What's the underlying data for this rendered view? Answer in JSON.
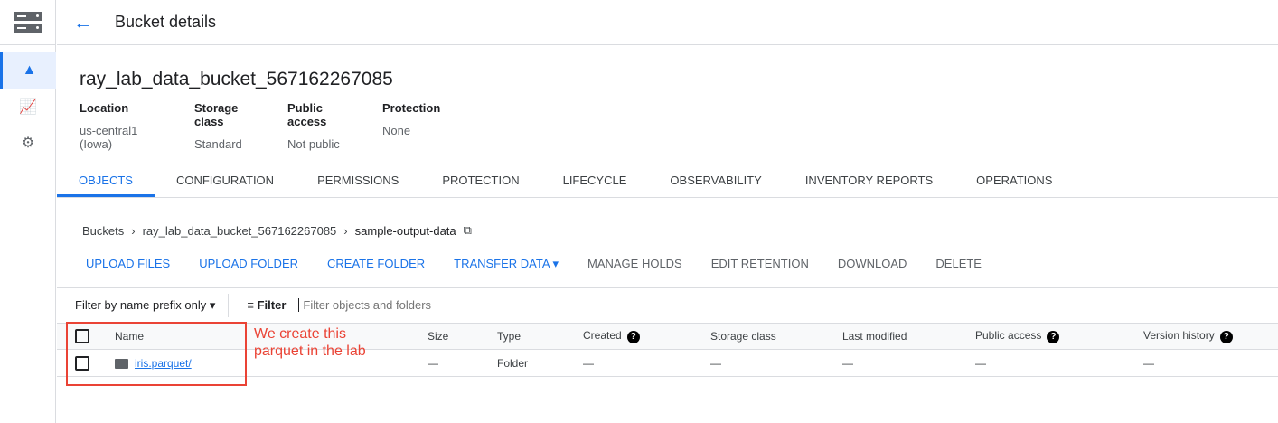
{
  "header": {
    "title": "Bucket details"
  },
  "bucket": {
    "name": "ray_lab_data_bucket_567162267085",
    "meta": [
      {
        "label": "Location",
        "value": "us-central1 (Iowa)"
      },
      {
        "label": "Storage class",
        "value": "Standard"
      },
      {
        "label": "Public access",
        "value": "Not public"
      },
      {
        "label": "Protection",
        "value": "None"
      }
    ]
  },
  "tabs": [
    "OBJECTS",
    "CONFIGURATION",
    "PERMISSIONS",
    "PROTECTION",
    "LIFECYCLE",
    "OBSERVABILITY",
    "INVENTORY REPORTS",
    "OPERATIONS"
  ],
  "breadcrumb": [
    "Buckets",
    "ray_lab_data_bucket_567162267085",
    "sample-output-data"
  ],
  "actions": {
    "upload_files": "UPLOAD FILES",
    "upload_folder": "UPLOAD FOLDER",
    "create_folder": "CREATE FOLDER",
    "transfer_data": "TRANSFER DATA",
    "manage_holds": "MANAGE HOLDS",
    "edit_retention": "EDIT RETENTION",
    "download": "DOWNLOAD",
    "delete": "DELETE"
  },
  "filter": {
    "prefix": "Filter by name prefix only",
    "label": "Filter",
    "placeholder": "Filter objects and folders"
  },
  "table": {
    "headers": [
      "Name",
      "Size",
      "Type",
      "Created",
      "Storage class",
      "Last modified",
      "Public access",
      "Version history"
    ],
    "rows": [
      {
        "name": "iris.parquet/",
        "size": "—",
        "type": "Folder",
        "created": "—",
        "storage_class": "—",
        "last_modified": "—",
        "public_access": "—",
        "version_history": "—"
      }
    ]
  },
  "annotation": "We create this parquet in the lab"
}
